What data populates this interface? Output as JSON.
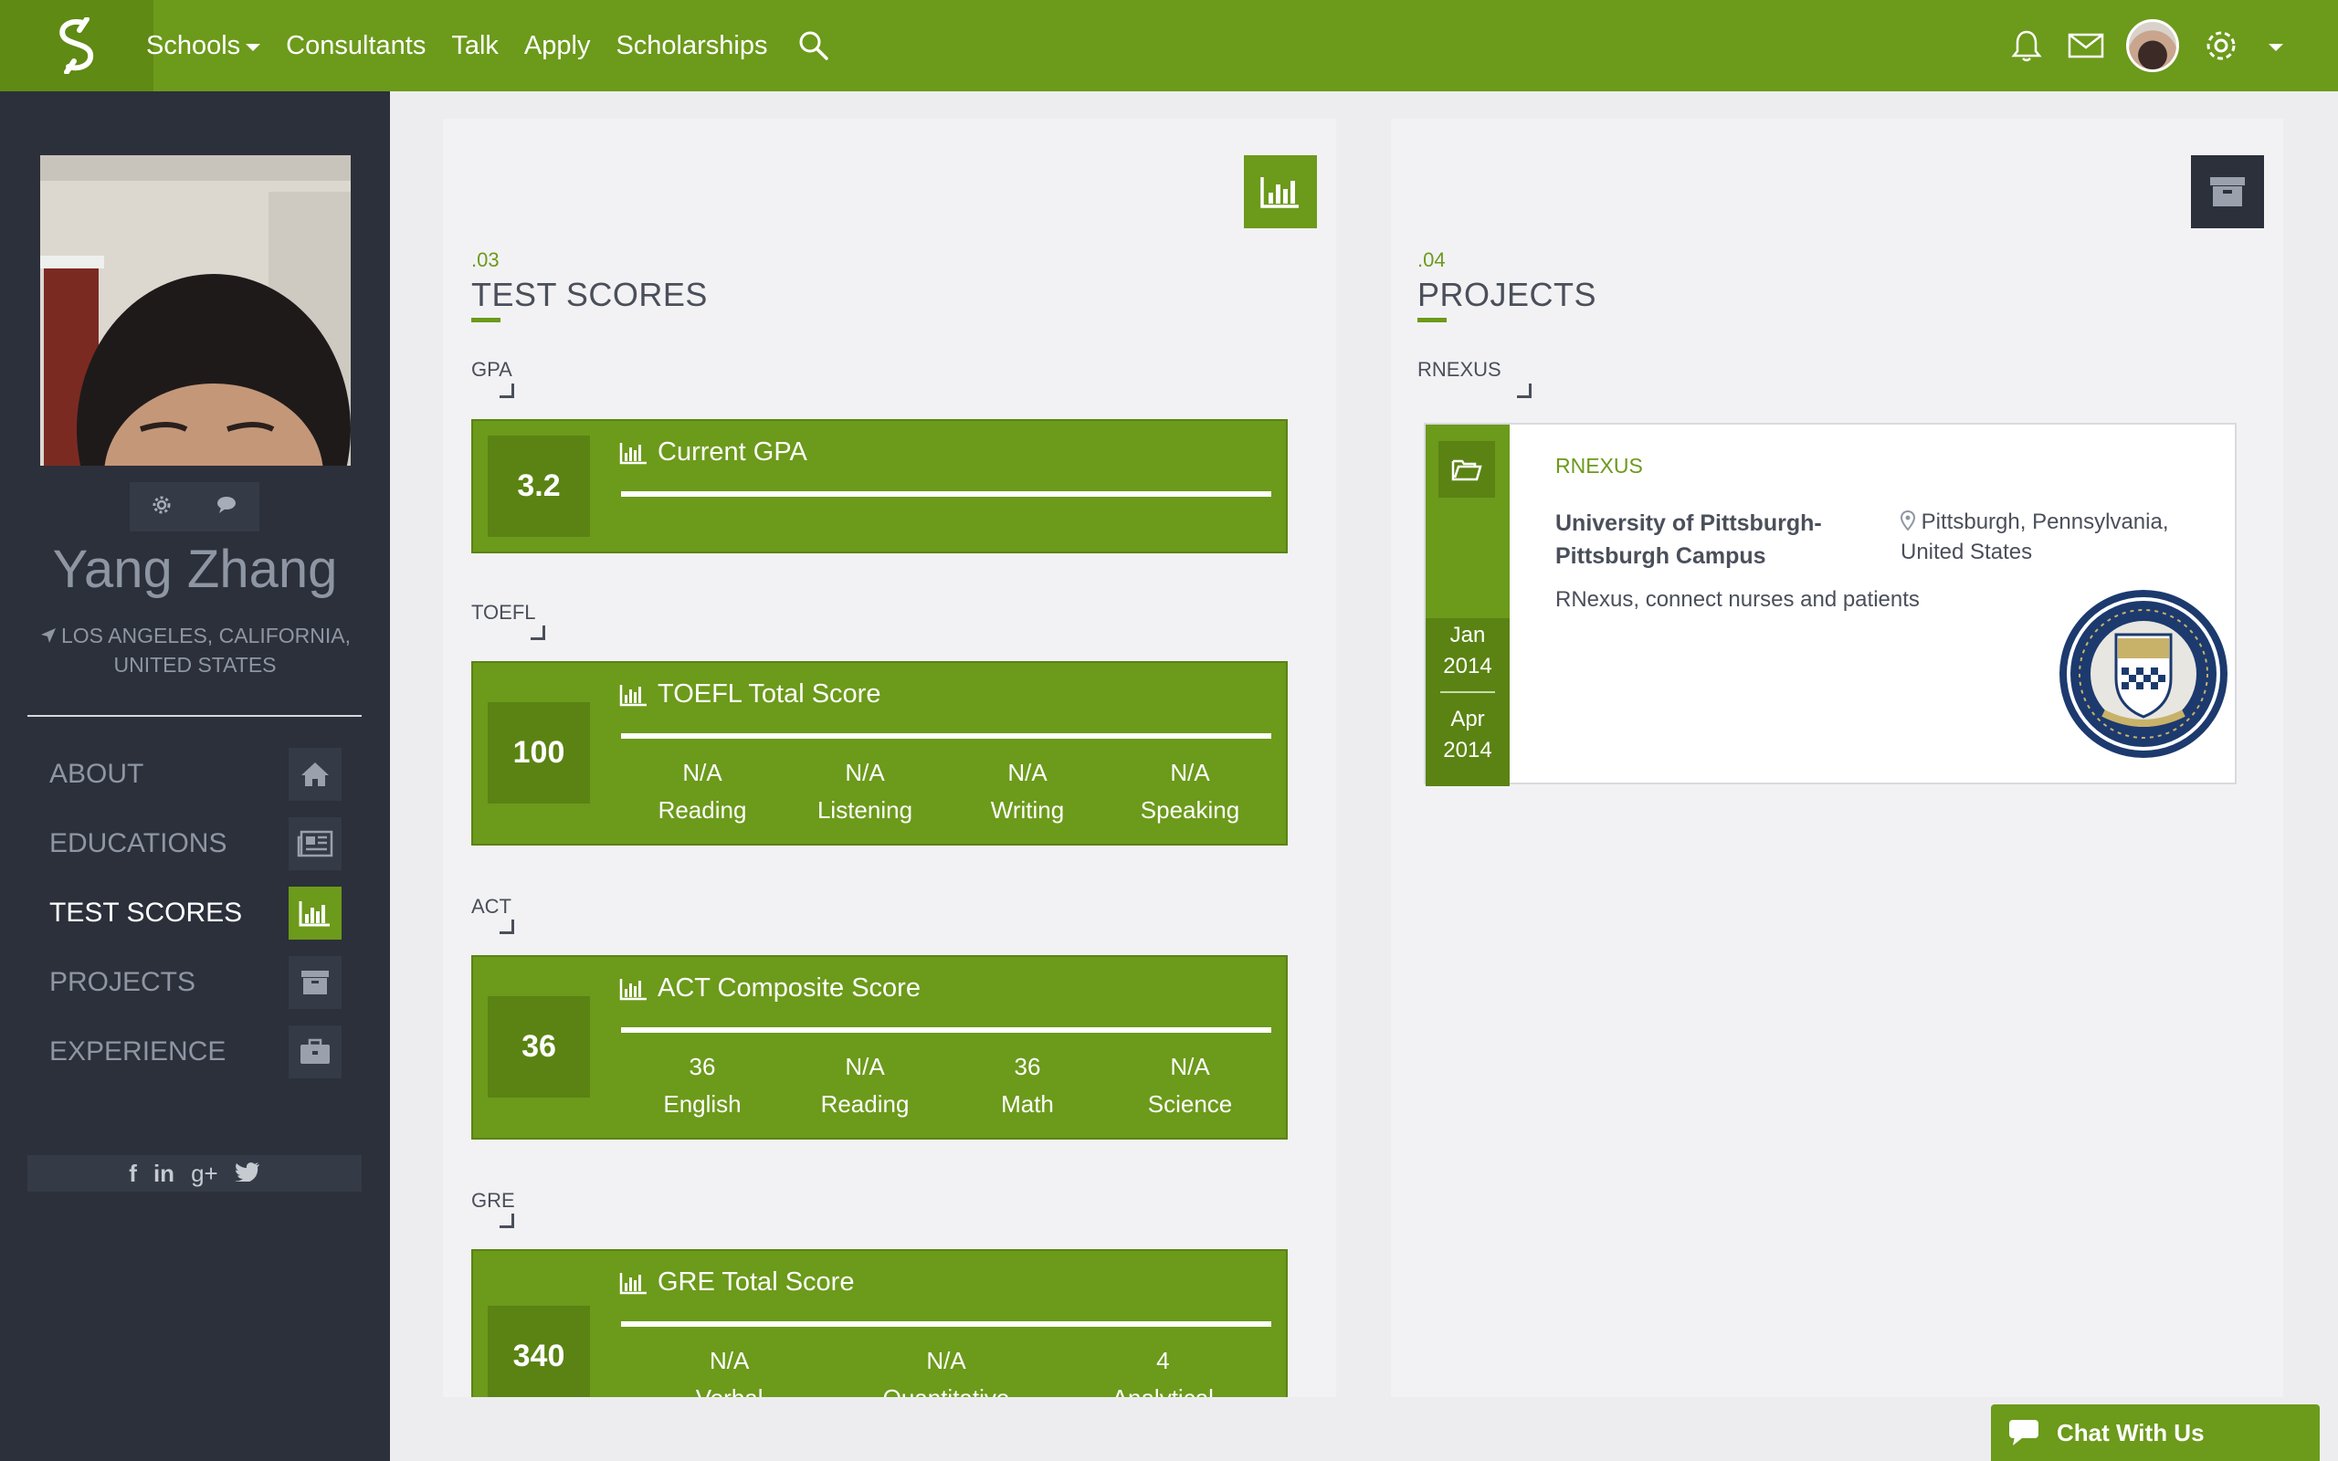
{
  "nav": {
    "items": [
      {
        "label": "Schools",
        "has_caret": true
      },
      {
        "label": "Consultants"
      },
      {
        "label": "Talk"
      },
      {
        "label": "Apply"
      },
      {
        "label": "Scholarships"
      }
    ],
    "icons": [
      "search-icon",
      "bell-icon",
      "mail-icon",
      "avatar",
      "gear-icon",
      "caret-down-icon"
    ]
  },
  "profile": {
    "name": "Yang Zhang",
    "location": "LOS ANGELES, CALIFORNIA, UNITED STATES"
  },
  "menu": [
    {
      "label": "ABOUT",
      "icon": "home-icon",
      "active": false
    },
    {
      "label": "EDUCATIONS",
      "icon": "newspaper-icon",
      "active": false
    },
    {
      "label": "TEST SCORES",
      "icon": "bar-chart-icon",
      "active": true
    },
    {
      "label": "PROJECTS",
      "icon": "archive-icon",
      "active": false
    },
    {
      "label": "EXPERIENCE",
      "icon": "briefcase-icon",
      "active": false
    }
  ],
  "social": {
    "facebook": "f",
    "linkedin": "in",
    "googleplus": "g+"
  },
  "test_scores": {
    "num": ".03",
    "title": "TEST SCORES",
    "gpa": {
      "label": "GPA",
      "score": "3.2",
      "title": "Current GPA"
    },
    "toefl": {
      "label": "TOEFL",
      "score": "100",
      "title": "TOEFL Total Score",
      "subs": [
        {
          "value": "N/A",
          "name": "Reading"
        },
        {
          "value": "N/A",
          "name": "Listening"
        },
        {
          "value": "N/A",
          "name": "Writing"
        },
        {
          "value": "N/A",
          "name": "Speaking"
        }
      ]
    },
    "act": {
      "label": "ACT",
      "score": "36",
      "title": "ACT Composite Score",
      "subs": [
        {
          "value": "36",
          "name": "English"
        },
        {
          "value": "N/A",
          "name": "Reading"
        },
        {
          "value": "36",
          "name": "Math"
        },
        {
          "value": "N/A",
          "name": "Science"
        }
      ]
    },
    "gre": {
      "label": "GRE",
      "score": "340",
      "title": "GRE Total Score",
      "subs": [
        {
          "value": "N/A",
          "name": "Verbal"
        },
        {
          "value": "N/A",
          "name": "Quantitative"
        },
        {
          "value": "4",
          "name": "Analytical"
        }
      ]
    }
  },
  "projects": {
    "num": ".04",
    "title": "PROJECTS",
    "group_label": "RNEXUS",
    "card": {
      "name": "RNEXUS",
      "school": "University of Pittsburgh-Pittsburgh Campus",
      "location": "Pittsburgh, Pennsylvania, United States",
      "description": "RNexus, connect nurses and patients",
      "start_month": "Jan",
      "start_year": "2014",
      "end_month": "Apr",
      "end_year": "2014",
      "seal_text": "UNIVERSITY OF PITTSBURGH"
    }
  },
  "chat": {
    "label": "Chat With Us"
  },
  "colors": {
    "brand": "#6c9a1b",
    "brand_dark": "#5a8313",
    "sidebar": "#2b303b"
  }
}
